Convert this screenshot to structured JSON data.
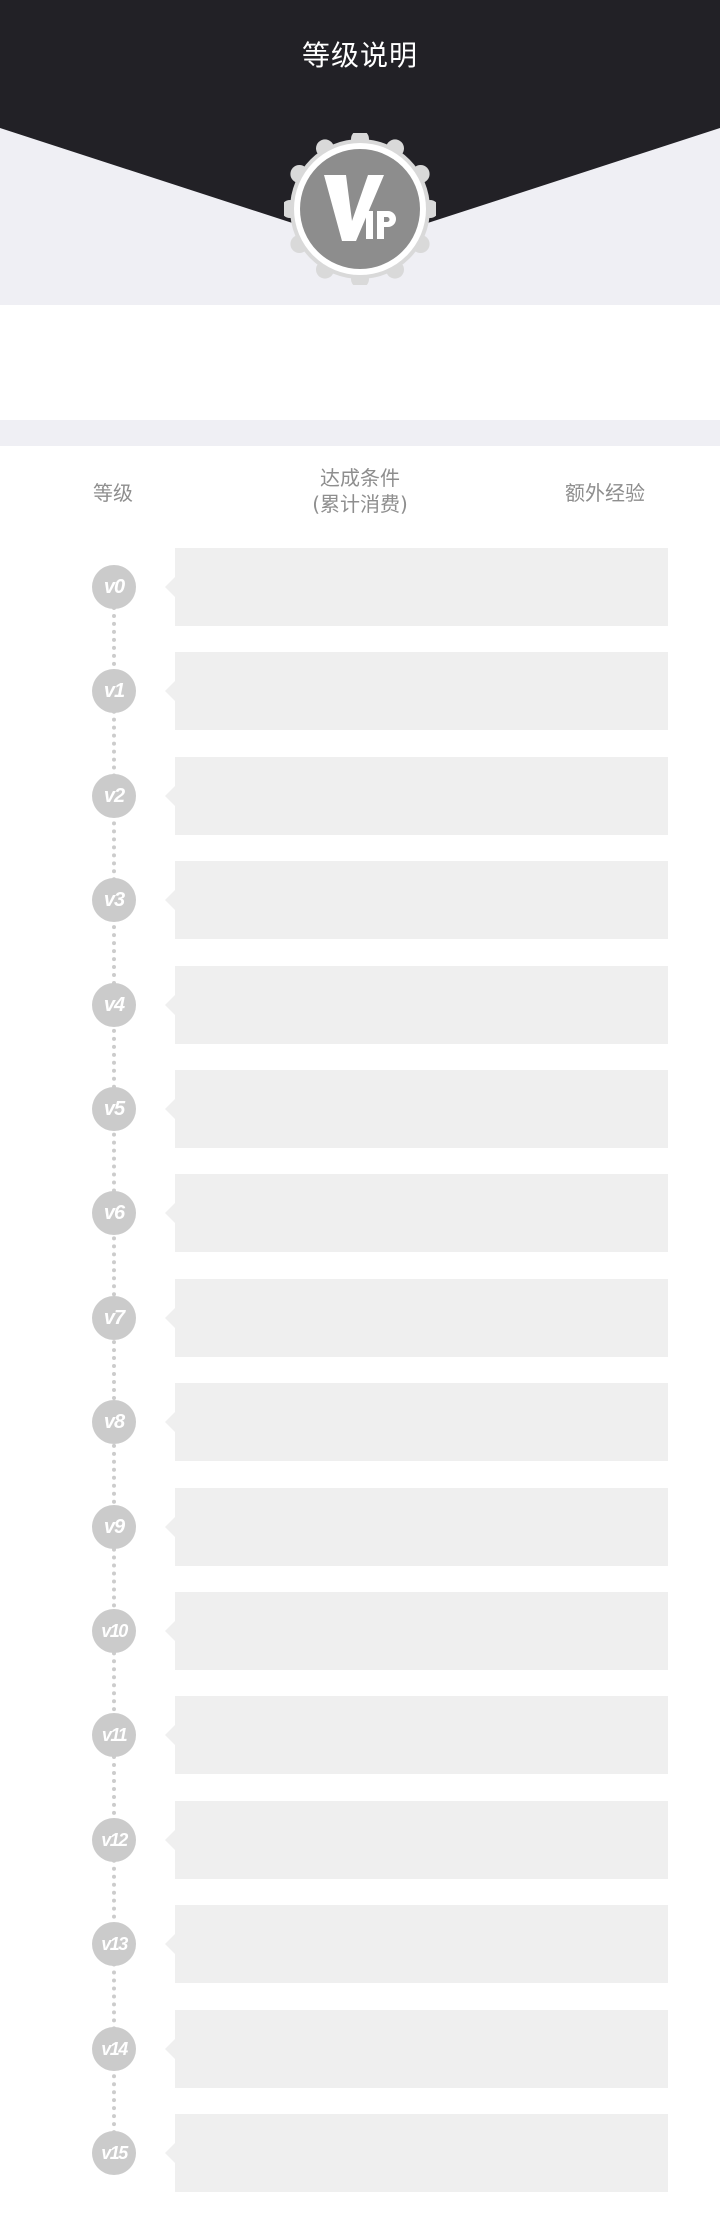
{
  "header": {
    "title": "等级说明",
    "badge_text": "VIP",
    "dark_color": "#222126",
    "light_color": "#efeff4"
  },
  "columns": {
    "level": "等级",
    "condition_line1": "达成条件",
    "condition_line2": "(累计消费)",
    "extra_exp": "额外经验"
  },
  "levels": [
    {
      "label": "v0",
      "condition": "",
      "extra_exp": ""
    },
    {
      "label": "v1",
      "condition": "",
      "extra_exp": ""
    },
    {
      "label": "v2",
      "condition": "",
      "extra_exp": ""
    },
    {
      "label": "v3",
      "condition": "",
      "extra_exp": ""
    },
    {
      "label": "v4",
      "condition": "",
      "extra_exp": ""
    },
    {
      "label": "v5",
      "condition": "",
      "extra_exp": ""
    },
    {
      "label": "v6",
      "condition": "",
      "extra_exp": ""
    },
    {
      "label": "v7",
      "condition": "",
      "extra_exp": ""
    },
    {
      "label": "v8",
      "condition": "",
      "extra_exp": ""
    },
    {
      "label": "v9",
      "condition": "",
      "extra_exp": ""
    },
    {
      "label": "v10",
      "condition": "",
      "extra_exp": ""
    },
    {
      "label": "v11",
      "condition": "",
      "extra_exp": ""
    },
    {
      "label": "v12",
      "condition": "",
      "extra_exp": ""
    },
    {
      "label": "v13",
      "condition": "",
      "extra_exp": ""
    },
    {
      "label": "v14",
      "condition": "",
      "extra_exp": ""
    },
    {
      "label": "v15",
      "condition": "",
      "extra_exp": ""
    }
  ]
}
